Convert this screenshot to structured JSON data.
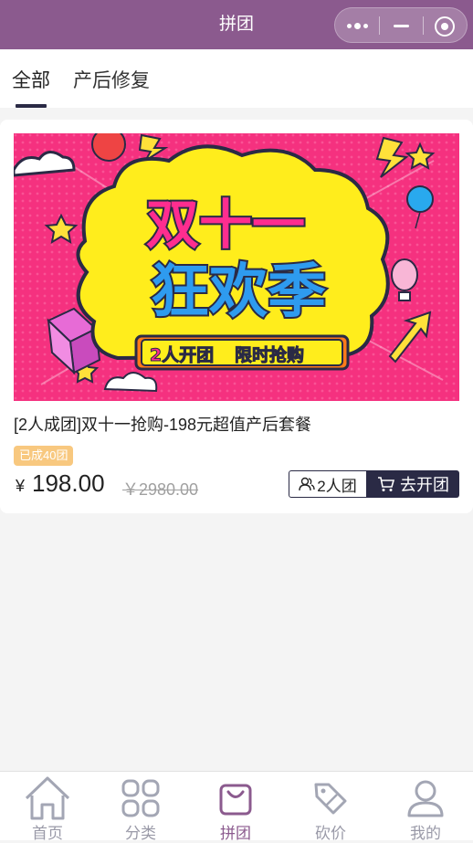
{
  "nav": {
    "title": "拼团",
    "background": "#8b5a8e",
    "capsule": {
      "more_icon": "more-dots-icon",
      "minimize_icon": "minimize-icon",
      "close_icon": "target-close-icon"
    }
  },
  "tabs": [
    {
      "label": "全部",
      "active": true
    },
    {
      "label": "产后修复",
      "active": false
    }
  ],
  "product": {
    "banner": {
      "headline_1": "双十一",
      "headline_2": "狂欢季",
      "tag_left": "2人开团",
      "tag_right": "限时抢购"
    },
    "title": "[2人成团]双十一抢购-198元超值产后套餐",
    "joined_badge": "已成40团",
    "currency": "¥",
    "price": "198.00",
    "original_price": "￥2980.00",
    "group_size_button": "2人团",
    "open_group_button": "去开团",
    "accent": "#2a2a45",
    "badge_color": "#f8c87f"
  },
  "tabbar": {
    "items": [
      {
        "label": "首页",
        "icon": "home-icon",
        "active": false
      },
      {
        "label": "分类",
        "icon": "grid-icon",
        "active": false
      },
      {
        "label": "拼团",
        "icon": "shopping-bag-icon",
        "active": true
      },
      {
        "label": "砍价",
        "icon": "price-tag-icon",
        "active": false
      },
      {
        "label": "我的",
        "icon": "user-icon",
        "active": false
      }
    ],
    "active_color": "#8b5a8e",
    "inactive_color": "#9a9aa8"
  }
}
